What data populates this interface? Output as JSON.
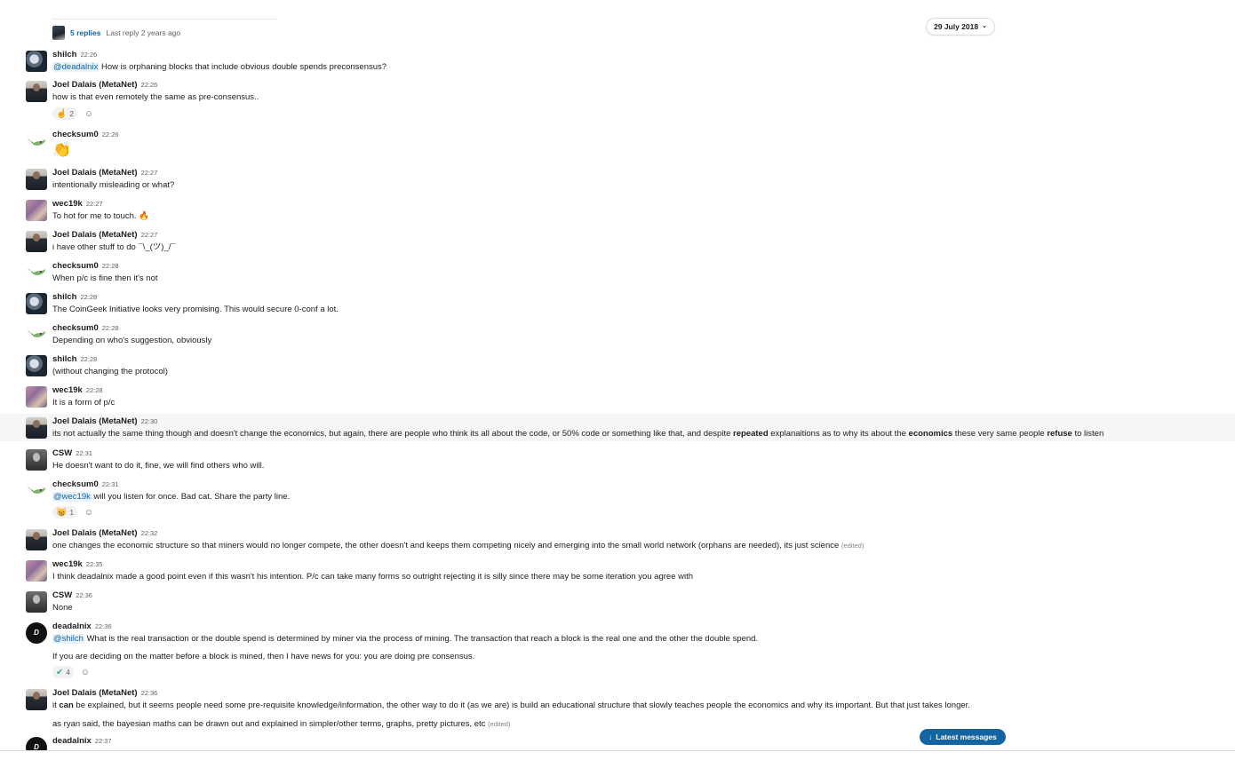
{
  "thread": {
    "replies": "5 replies",
    "last_reply": "Last reply 2 years ago"
  },
  "date_divider": {
    "label": "29 July 2018",
    "chevron": "⌄"
  },
  "messages": [
    {
      "name": "shilch",
      "time": "22:26",
      "mention": "@deadalnix",
      "text": " How is orphaning blocks that include obvious double spends preconsensus?"
    },
    {
      "name": "Joel Dalais (MetaNet)",
      "time": "22:26",
      "text": "how is that even remotely the same as pre-consensus..",
      "reaction_emoji": "☝",
      "reaction_count": "2"
    },
    {
      "name": "checksum0",
      "time": "22:26",
      "emoji": "👏"
    },
    {
      "name": "Joel Dalais (MetaNet)",
      "time": "22:27",
      "text": "intentionally misleading or what?"
    },
    {
      "name": "wec19k",
      "time": "22:27",
      "text": "To hot for me to touch. ",
      "emoji": "🔥"
    },
    {
      "name": "Joel Dalais (MetaNet)",
      "time": "22:27",
      "text": "i have other stuff to do ¯\\_(ツ)_/¯"
    },
    {
      "name": "checksum0",
      "time": "22:28",
      "text": "When p/c is fine then it's not"
    },
    {
      "name": "shilch",
      "time": "22:28",
      "text": "The CoinGeek Initiative looks very promising. This would secure 0-conf a lot."
    },
    {
      "name": "checksum0",
      "time": "22:28",
      "text": "Depending on who's suggestion, obviously"
    },
    {
      "name": "shilch",
      "time": "22:28",
      "text": "(without changing the protocol)"
    },
    {
      "name": "wec19k",
      "time": "22:28",
      "text": "It is a form of p/c"
    },
    {
      "name": "Joel Dalais (MetaNet)",
      "time": "22:30",
      "t1": "its not actually the same thing though and doesn't change the economics, but again, there are people who think its all about the code, or 50% code or something like that, and despite ",
      "b1": "repeated",
      "t2": " explanaitions as to why its about the ",
      "b2": "economics",
      "t3": " these very same people ",
      "b3": "refuse",
      "t4": " to listen"
    },
    {
      "name": "CSW",
      "time": "22:31",
      "text": "He doesn't want to do it, fine, we will find others who will."
    },
    {
      "name": "checksum0",
      "time": "22:31",
      "mention": "@wec19k",
      "text": " will you listen for once. Bad cat. Share the party line.",
      "reaction_emoji": "😸",
      "reaction_count": "1"
    },
    {
      "name": "Joel Dalais (MetaNet)",
      "time": "22:32",
      "text": "one changes the economic structure so that miners would no longer compete, the other doesn't and keeps them competing nicely and emerging into the small world network (orphans are needed), its just science ",
      "edited": "(edited)"
    },
    {
      "name": "wec19k",
      "time": "22:35",
      "text": "I think deadalnix made a good point even if this wasn't his intention. P/c can take many forms so outright rejecting it is silly since there may be some iteration you agree with"
    },
    {
      "name": "CSW",
      "time": "22:36",
      "text": "None"
    },
    {
      "name": "deadalnix",
      "time": "22:36",
      "mention": "@shilch",
      "text": " What is the real transaction or the double spend is determined by miner via the process of mining. The transaction that reach a block is the real one and the other the double spend.",
      "text2": "If you are deciding on the matter before a block is mined, then I have news for you: you are doing pre consensus.",
      "reaction_emoji": "✔",
      "reaction_count": "4"
    },
    {
      "name": "Joel Dalais (MetaNet)",
      "time": "22:36",
      "t1": "it ",
      "b1": "can",
      "t2": " be explained, but it seems people need some pre-requisite knowledge/information, the other way to do it (as we are) is build an educational structure that slowly teaches people the economics and why its important. But that just takes longer.",
      "text2": "as ryan said, the bayesian maths can be drawn out and explained in simpler/other terms, graphs, pretty pictures, etc ",
      "edited": "(edited)"
    },
    {
      "name": "deadalnix",
      "time": "22:37"
    }
  ],
  "avatar_initials": {
    "deadalnix": "D"
  },
  "add_reaction_icon": "☺",
  "latest_button": {
    "arrow": "↓",
    "label": "Latest messages"
  }
}
